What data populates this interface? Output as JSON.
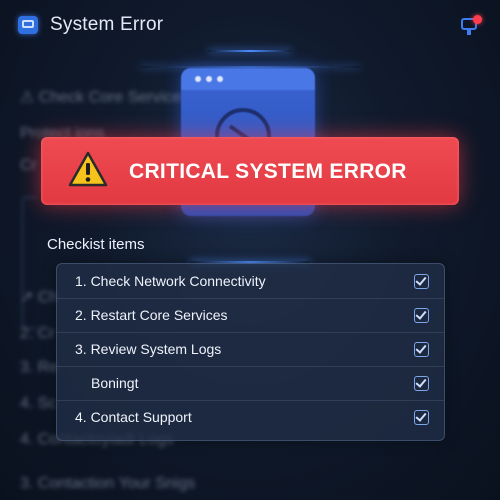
{
  "app": {
    "title": "System Error"
  },
  "background_sidebar": {
    "items": [
      "⚠ Check Core Services",
      "Protect ions",
      "Cr",
      "↗ Ch",
      "2. Cr",
      "3. Re",
      "4. Sc",
      "4. Contactoyiadl Logs",
      "3. Contaction Your Snigs"
    ]
  },
  "banner": {
    "text": "CRITICAL SYSTEM ERROR",
    "color": "#e8434b"
  },
  "checklist": {
    "heading": "Checkist items",
    "items": [
      {
        "label": "1.  Check Network Connectivity",
        "checked": true
      },
      {
        "label": "2. Restart Core Services",
        "checked": true
      },
      {
        "label": "3. Review System Logs",
        "checked": true
      },
      {
        "label": "Boningt",
        "checked": true
      },
      {
        "label": "4.  Contact Support",
        "checked": true
      }
    ]
  },
  "icons": [
    "app-icon",
    "notification-alert-icon",
    "warning-icon",
    "checkbox-checked-icon"
  ]
}
